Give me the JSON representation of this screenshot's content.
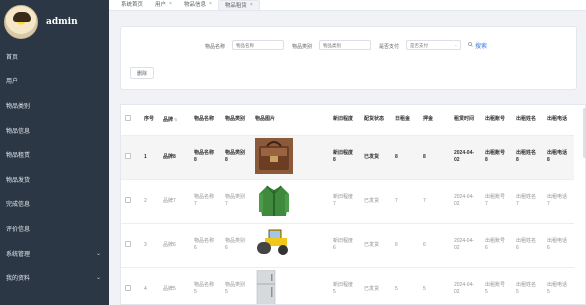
{
  "user": {
    "name": "admin"
  },
  "sidebar": {
    "items": [
      {
        "label": "首页",
        "chevron": false
      },
      {
        "label": "用户",
        "chevron": false
      },
      {
        "label": "物品类别",
        "chevron": false
      },
      {
        "label": "物品信息",
        "chevron": false
      },
      {
        "label": "物品租赁",
        "chevron": false
      },
      {
        "label": "物品发货",
        "chevron": false
      },
      {
        "label": "完成信息",
        "chevron": false
      },
      {
        "label": "评价信息",
        "chevron": false
      },
      {
        "label": "系统管理",
        "chevron": true
      },
      {
        "label": "我的资料",
        "chevron": true
      }
    ]
  },
  "tabs": [
    {
      "label": "系统首页",
      "closable": false,
      "active": false
    },
    {
      "label": "用户",
      "closable": true,
      "active": false
    },
    {
      "label": "物品信息",
      "closable": true,
      "active": false
    },
    {
      "label": "物品租赁",
      "closable": true,
      "active": true
    }
  ],
  "search": {
    "name_label": "物品名称",
    "name_placeholder": "物品名称",
    "category_label": "物品类别",
    "category_placeholder": "物品类别",
    "paid_label": "是否支付",
    "paid_placeholder": "是否支付",
    "search_button": "搜索",
    "delete_button": "删除"
  },
  "table": {
    "headers": [
      "序号",
      "品牌",
      "物品名称",
      "物品类别",
      "物品图片",
      "新旧程度",
      "配货状态",
      "日租金",
      "押金",
      "租赁时间",
      "出租账号",
      "出租姓名",
      "出租电话"
    ],
    "rows": [
      {
        "index": "1",
        "brand": "品牌8",
        "name": "物品名称8",
        "category": "物品类别8",
        "image": "bag",
        "condition": "新旧程度8",
        "status": "已发货",
        "rent": "8",
        "deposit": "8",
        "time": "2024-04-02",
        "account": "出租账号8",
        "renter": "出租姓名8",
        "phone": "出租电话8"
      },
      {
        "index": "2",
        "brand": "品牌7",
        "name": "物品名称7",
        "category": "物品类别7",
        "image": "jacket",
        "condition": "新旧程度7",
        "status": "已发货",
        "rent": "7",
        "deposit": "7",
        "time": "2024-04-02",
        "account": "出租账号7",
        "renter": "出租姓名7",
        "phone": "出租电话7"
      },
      {
        "index": "3",
        "brand": "品牌6",
        "name": "物品名称6",
        "category": "物品类别6",
        "image": "roller",
        "condition": "新旧程度6",
        "status": "已发货",
        "rent": "6",
        "deposit": "6",
        "time": "2024-04-02",
        "account": "出租账号6",
        "renter": "出租姓名6",
        "phone": "出租电话6"
      },
      {
        "index": "4",
        "brand": "品牌5",
        "name": "物品名称5",
        "category": "物品类别5",
        "image": "fridge",
        "condition": "新旧程度5",
        "status": "已发货",
        "rent": "5",
        "deposit": "5",
        "time": "2024-04-02",
        "account": "出租账号5",
        "renter": "出租姓名5",
        "phone": "出租电话5"
      }
    ]
  },
  "colors": {
    "sidebar_bg": "#2b3744",
    "accent": "#3a7ce8",
    "highlight_row": "#f5f5f5"
  }
}
